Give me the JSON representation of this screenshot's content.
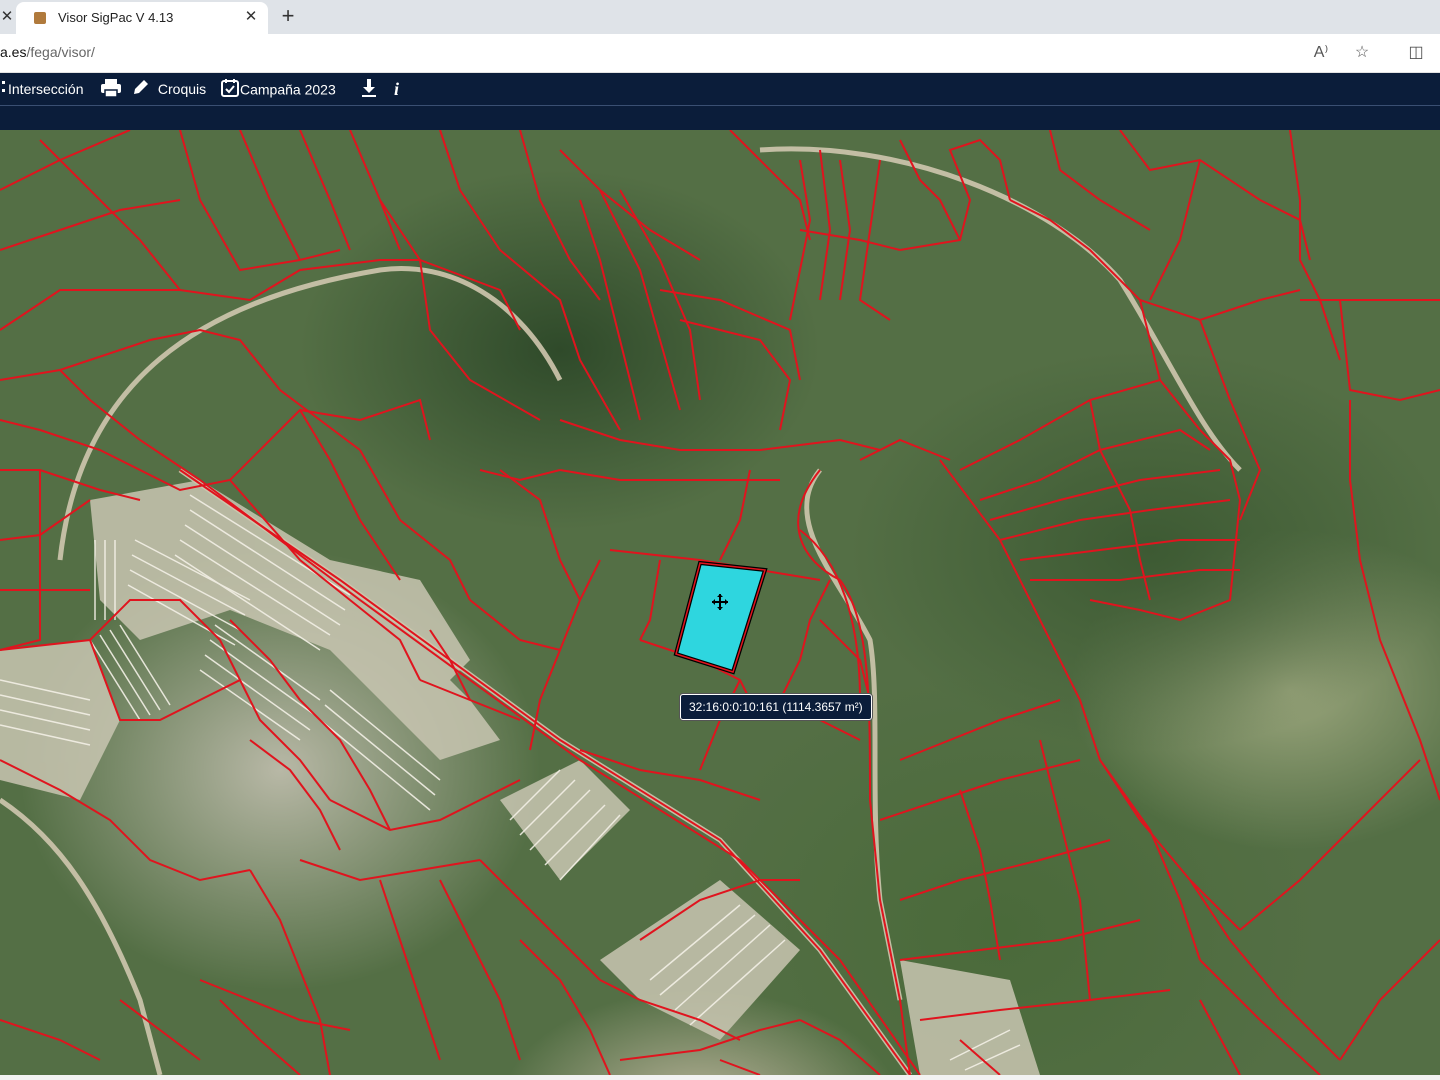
{
  "browser": {
    "tab": {
      "title": "Visor SigPac V 4.13",
      "close_symbol": "✕"
    },
    "prev_tab_close_symbol": "✕",
    "new_tab_symbol": "+",
    "address": {
      "url_domain": "a.es",
      "url_path": "/fega/visor/"
    },
    "actions": [
      {
        "name": "read-aloud-icon",
        "glyph": "A⁾"
      },
      {
        "name": "favorite-star-icon",
        "glyph": "☆"
      },
      {
        "name": "split-screen-icon",
        "glyph": "◫"
      }
    ]
  },
  "toolbar": {
    "intersection_label": "Intersección",
    "print_icon": "printer-icon",
    "sketch_label": "Croquis",
    "campaign_label": "Campaña 2023",
    "download_icon": "download-icon",
    "info_label": "i"
  },
  "map": {
    "selected_parcel_tooltip": "32:16:0:0:10:161 (1114.3657 m²)",
    "selection_color": "#2ed6df",
    "boundary_color": "#e0141e",
    "cursor_icon": "move-cursor-icon"
  }
}
